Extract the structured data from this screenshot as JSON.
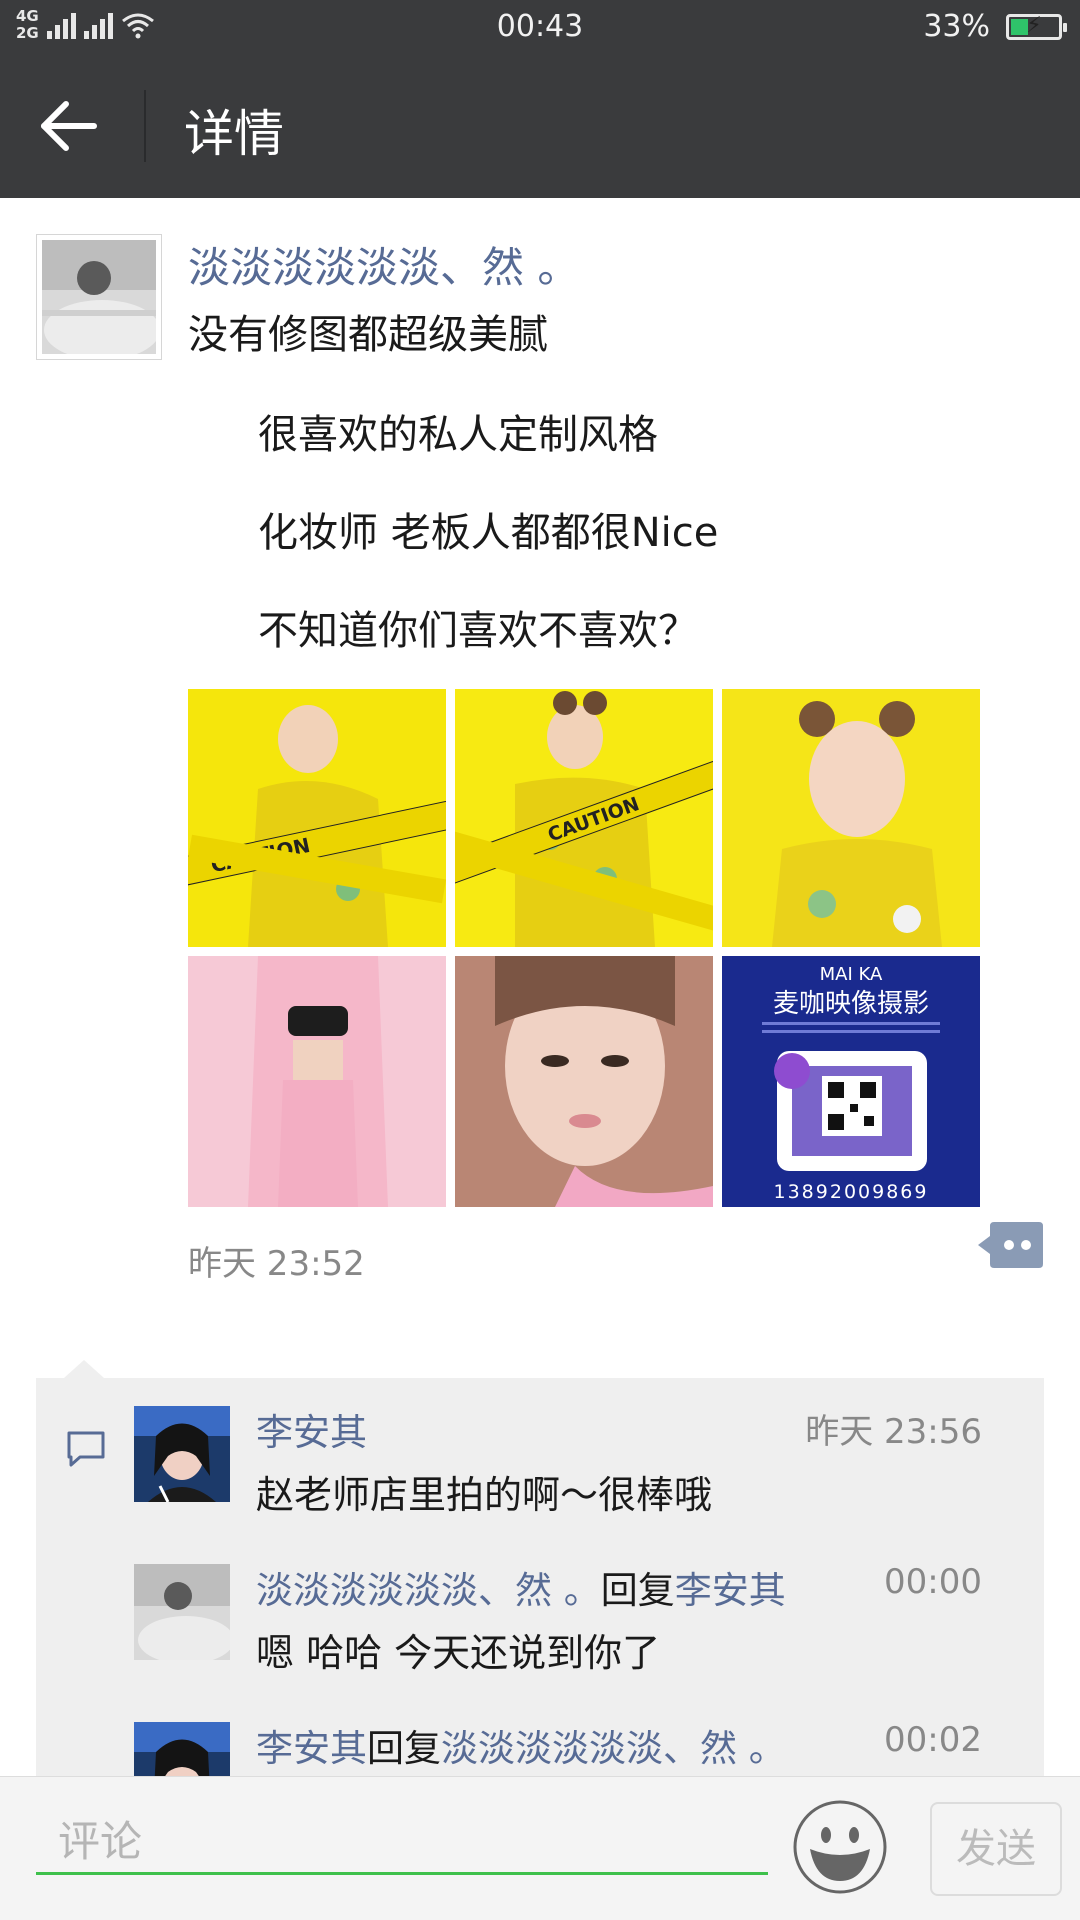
{
  "status_bar": {
    "network_top": "4G",
    "network_bottom": "2G",
    "time": "00:43",
    "battery_text": "33%",
    "battery_level": 0.33,
    "icons": [
      "signal-icon",
      "wifi-icon",
      "battery-charging-icon"
    ]
  },
  "header": {
    "title": "详情",
    "back_icon": "arrow-left-icon"
  },
  "post": {
    "author": "淡淡淡淡淡淡、然 。",
    "lines": [
      "没有修图都超级美腻",
      "很喜欢的私人定制风格",
      "化妆师 老板人都都很Nice",
      "不知道你们喜欢不喜欢？"
    ],
    "image_count": 6,
    "ad_image_text": {
      "brand_en": "MAI KA",
      "brand_cn": "麦咖映像摄影",
      "phone": "13892009869"
    },
    "image_texts": [
      "CAUTION",
      "CAUTION",
      "CAUTION"
    ],
    "timestamp": "昨天 23:52"
  },
  "comments": [
    {
      "author": "李安其",
      "reply_word": "",
      "reply_to": "",
      "time": "昨天 23:56",
      "text": "赵老师店里拍的啊～很棒哦"
    },
    {
      "author": "淡淡淡淡淡淡、然 。",
      "reply_word": "回复",
      "reply_to": "李安其",
      "time": "00:00",
      "text": "嗯 哈哈 今天还说到你了"
    },
    {
      "author": "李安其",
      "reply_word": "回复",
      "reply_to": "淡淡淡淡淡淡、然 。",
      "time": "00:02",
      "text": ""
    }
  ],
  "input": {
    "placeholder": "评论",
    "send_label": "发送"
  },
  "colors": {
    "header_bg": "#3a3b3d",
    "name_link": "#576b95",
    "input_underline": "#3ec04b",
    "comment_bg": "#efefef"
  }
}
